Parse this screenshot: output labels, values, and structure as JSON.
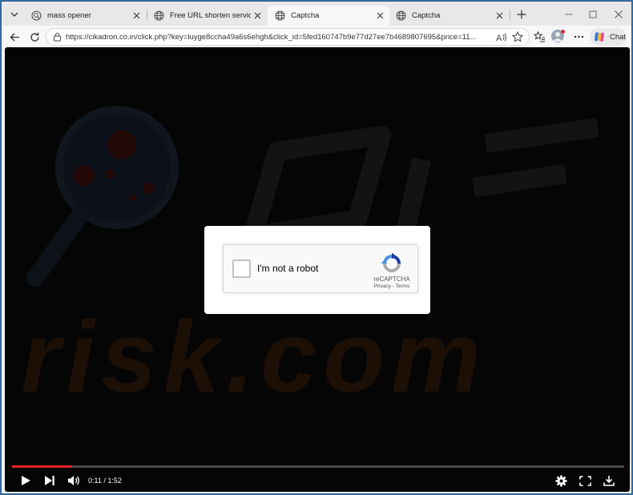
{
  "tabs": [
    {
      "title": "mass opener",
      "icon": "search-tab-icon",
      "active": false
    },
    {
      "title": "Free URL shorten service - ou",
      "icon": "globe-icon",
      "active": false
    },
    {
      "title": "Captcha",
      "icon": "globe-icon",
      "active": true
    },
    {
      "title": "Captcha",
      "icon": "globe-icon",
      "active": false
    }
  ],
  "toolbar": {
    "url": "https://cikadron.co.in/click.php?key=luyge8ccha49a6s6ehgh&click_id=5fed160747b9e77d27ee7b4689807695&price=11...",
    "chat_label": "Chat"
  },
  "watermark": {
    "text": "risk.com"
  },
  "captcha": {
    "label": "I'm not a robot",
    "brand": "reCAPTCHA",
    "privacy": "Privacy",
    "separator": " - ",
    "terms": "Terms"
  },
  "player": {
    "current_time": "0:11",
    "separator": " / ",
    "duration": "1:52",
    "progress_fraction": 0.098
  },
  "colors": {
    "progress": "#e52420",
    "recaptcha_blue": "#1c3aa9",
    "recaptcha_lightblue": "#4a90e2",
    "recaptcha_gray": "#ababab"
  }
}
